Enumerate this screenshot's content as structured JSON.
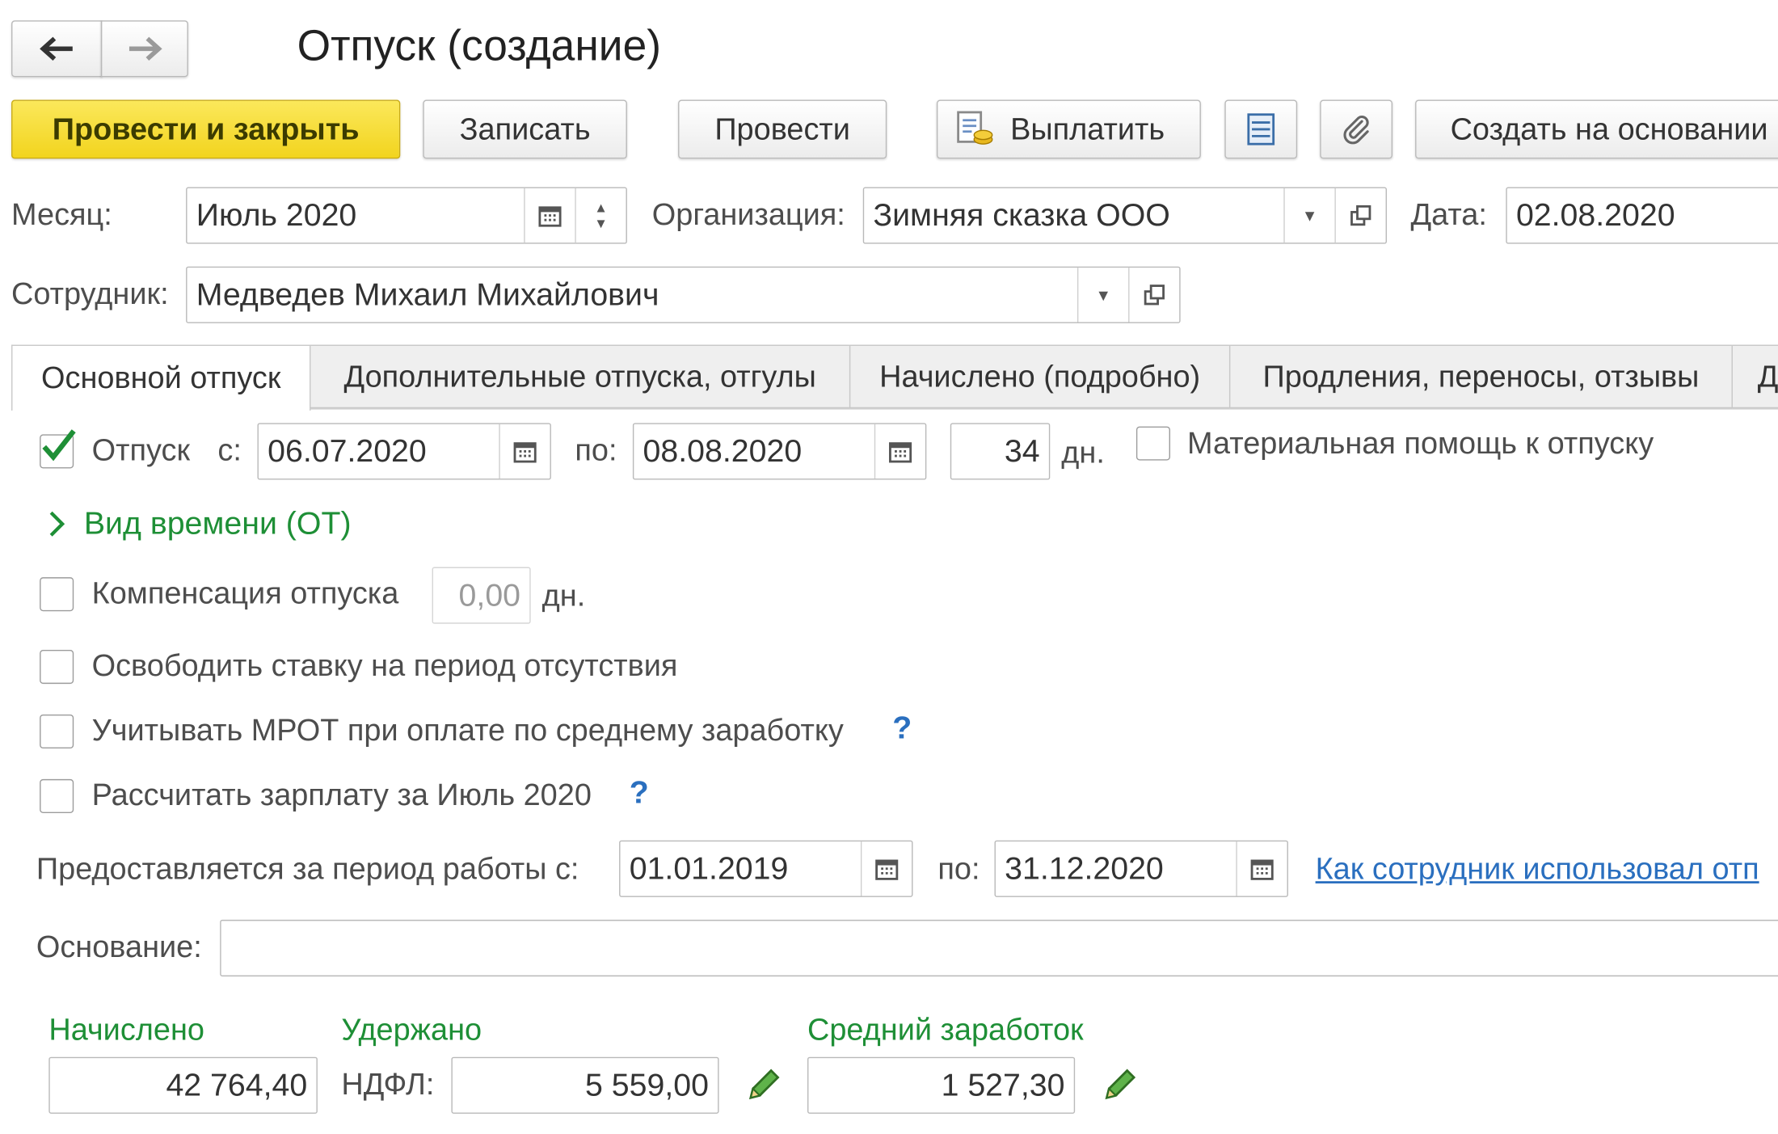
{
  "window": {
    "title": "Отпуск (создание)"
  },
  "nav": {
    "back_icon": "arrow-left-icon",
    "forward_icon": "arrow-right-icon"
  },
  "toolbar": {
    "post_close": "Провести и закрыть",
    "save": "Записать",
    "post": "Провести",
    "pay": "Выплатить",
    "create_based": "Создать на основании"
  },
  "header": {
    "month_label": "Месяц:",
    "month_value": "Июль 2020",
    "org_label": "Организация:",
    "org_value": "Зимняя сказка ООО",
    "date_label": "Дата:",
    "date_value": "02.08.2020",
    "employee_label": "Сотрудник:",
    "employee_value": "Медведев Михаил Михайлович"
  },
  "tabs": [
    {
      "label": "Основной отпуск"
    },
    {
      "label": "Дополнительные отпуска, отгулы"
    },
    {
      "label": "Начислено (подробно)"
    },
    {
      "label": "Продления, переносы, отзывы"
    },
    {
      "label": "Д"
    }
  ],
  "vacation": {
    "checkbox_label": "Отпуск",
    "checked": true,
    "from_label": "с:",
    "from_value": "06.07.2020",
    "to_label": "по:",
    "to_value": "08.08.2020",
    "days_value": "34",
    "days_unit": "дн.",
    "material_aid_label": "Материальная помощь к отпуску"
  },
  "time_kind": {
    "label": "Вид времени (ОТ)"
  },
  "compensation": {
    "label": "Компенсация отпуска",
    "value": "0,00",
    "unit": "дн."
  },
  "release_rate": {
    "label": "Освободить ставку на период отсутствия"
  },
  "mrot": {
    "label": "Учитывать МРОТ при оплате по среднему заработку",
    "help": "?"
  },
  "calc_salary": {
    "label": "Рассчитать зарплату за Июль 2020",
    "help": "?"
  },
  "work_period": {
    "label": "Предоставляется за период работы с:",
    "from_value": "01.01.2019",
    "to_label": "по:",
    "to_value": "31.12.2020",
    "link": "Как сотрудник использовал отп"
  },
  "basis": {
    "label": "Основание:",
    "value": ""
  },
  "totals": {
    "accrued_label": "Начислено",
    "accrued_value": "42 764,40",
    "withheld_label": "Удержано",
    "ndfl_label": "НДФЛ:",
    "ndfl_value": "5 559,00",
    "avg_label": "Средний заработок",
    "avg_value": "1 527,30"
  },
  "colors": {
    "accent_yellow": "#f2d41e",
    "green_text": "#1e8f36",
    "link_blue": "#2a6fbf"
  }
}
